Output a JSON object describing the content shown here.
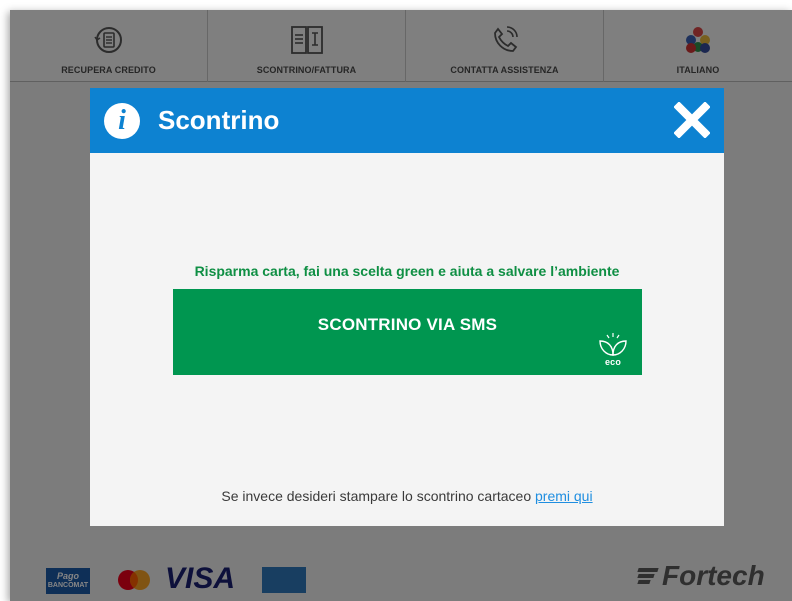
{
  "nav": {
    "items": [
      {
        "label": "RECUPERA CREDITO",
        "icon": "coin-refresh-icon"
      },
      {
        "label": "SCONTRINO/FATTURA",
        "icon": "receipt-icon"
      },
      {
        "label": "CONTATTA ASSISTENZA",
        "icon": "phone-icon"
      },
      {
        "label": "ITALIANO",
        "icon": "flags-icon"
      }
    ]
  },
  "modal": {
    "title": "Scontrino",
    "info_icon": "info-icon",
    "close_icon": "close-icon",
    "promo_text": "Risparma carta, fai una scelta green e aiuta a salvare l’ambiente",
    "sms_button_label": "SCONTRINO VIA SMS",
    "eco_label": "eco",
    "bottom_text": "Se invece desideri stampare lo scontrino cartaceo",
    "bottom_link": "premi qui"
  },
  "footer": {
    "pagobancomat_top": "Pago",
    "pagobancomat_bottom": "BANCOMAT",
    "visa": "VISA",
    "brand": "Fortech"
  },
  "colors": {
    "header_blue": "#0d82d1",
    "green": "#009650",
    "green_text": "#0f8f44",
    "link": "#1f8ee0"
  }
}
